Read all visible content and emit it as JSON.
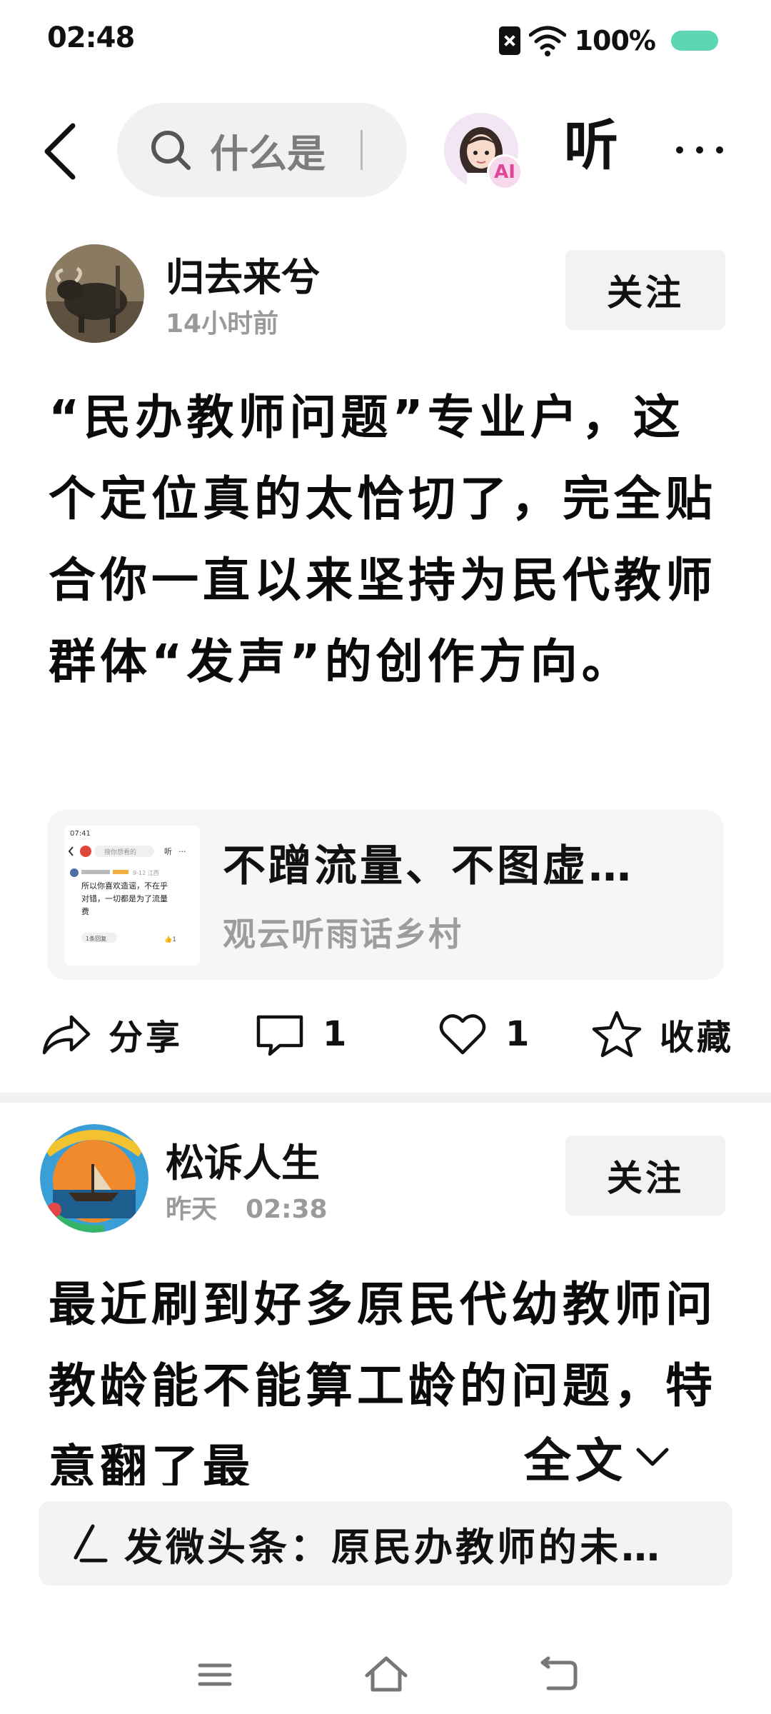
{
  "status_bar": {
    "time": "02:48",
    "battery": "100%",
    "battery_color": "#5dd6b3"
  },
  "top_bar": {
    "search_placeholder": "什么是",
    "ai_badge": "AI",
    "listen_label": "听"
  },
  "posts": [
    {
      "author": "归去来兮",
      "time": "14小时前",
      "follow_label": "关注",
      "body": "“民办教师问题”专业户，这个定位真的太恰切了，完全贴合你一直以来坚持为民代教师群体“发声”的创作方向。",
      "quote": {
        "title": "不蹭流量、不图虚…",
        "source": "观云听雨话乡村",
        "thumb": {
          "time": "07:41",
          "search": "搜你想看的",
          "listen": "听",
          "date": "9-12 江西",
          "line1": "所以你喜欢造谣，不在乎",
          "line2": "对错，一切都是为了流量",
          "line3": "费",
          "reply": "1条回复"
        }
      },
      "actions": {
        "share": "分享",
        "comments": "1",
        "likes": "1",
        "favorite": "收藏"
      }
    },
    {
      "author": "松诉人生",
      "time_day": "昨天",
      "time_clock": "02:38",
      "follow_label": "关注",
      "body": "最近刷到好多原民代幼教师问教龄能不能算工龄的问题，特意翻了最",
      "expand_label": "全文"
    }
  ],
  "compose": {
    "text": "发微头条：原民办教师的未…"
  }
}
